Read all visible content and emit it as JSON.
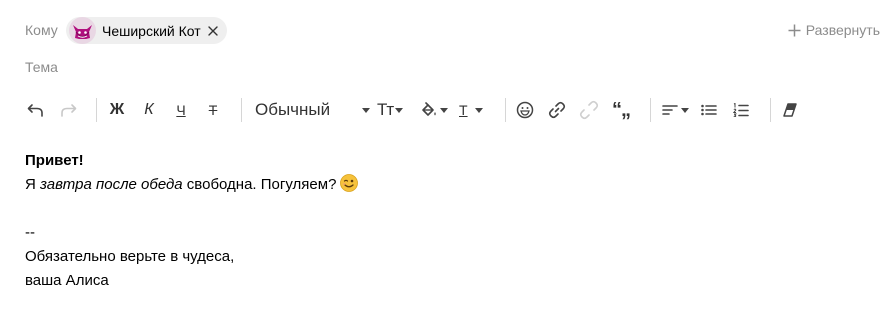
{
  "header": {
    "to_label": "Кому",
    "recipient": {
      "name": "Чеширский Кот",
      "avatar_icon": "cheshire-cat-avatar-icon",
      "remove_icon": "close-icon"
    },
    "expand_label": "Развернуть",
    "expand_icon": "plus-icon",
    "subject_label": "Тема"
  },
  "toolbar": {
    "undo_icon": "undo-icon",
    "redo_icon": "redo-icon",
    "bold_label": "Ж",
    "italic_label": "К",
    "underline_label": "Ч",
    "strike_label": "Т",
    "style_select": "Обычный",
    "font_size_label": "Тт",
    "fill_icon": "paint-bucket-icon",
    "text_color_label": "Т",
    "emoji_icon": "emoji-icon",
    "link_icon": "link-icon",
    "unlink_icon": "unlink-icon",
    "quote_label": "“„",
    "align_icon": "align-left-icon",
    "bullet_list_icon": "bulleted-list-icon",
    "numbered_list_icon": "numbered-list-icon",
    "clear_format_icon": "eraser-icon"
  },
  "body": {
    "greeting": "Привет!",
    "line2_prefix": "Я ",
    "line2_italic": "завтра после обеда",
    "line2_suffix": " свободна. Погуляем?",
    "line2_emoji": "winking-face-emoji",
    "sig_separator": "--",
    "sig_line1": "Обязательно верьте в чудеса,",
    "sig_line2": "ваша Алиса"
  },
  "colors": {
    "label_gray": "#8c8c8c",
    "chip_bg": "#efefef",
    "avatar_purple": "#b0107e",
    "toolbar_icon": "#333333",
    "separator": "#d6d6d6"
  }
}
